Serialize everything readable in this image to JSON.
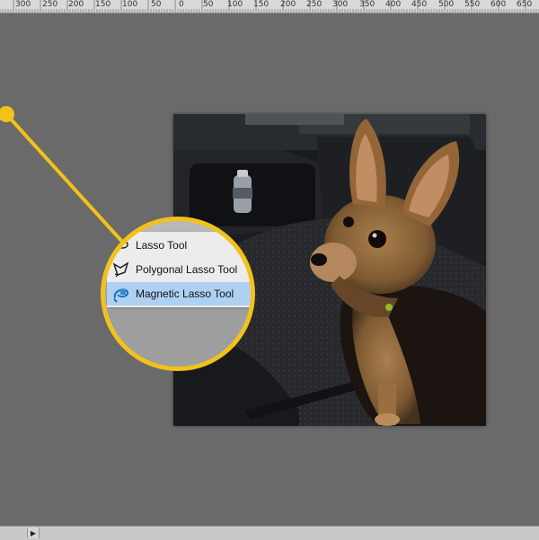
{
  "ruler": {
    "labels": [
      "300",
      "250",
      "200",
      "150",
      "100",
      "50",
      "0",
      "50",
      "100",
      "150",
      "200",
      "250",
      "300",
      "350",
      "400",
      "450",
      "500",
      "550",
      "600",
      "650"
    ]
  },
  "menu": {
    "items": [
      {
        "label": "Lasso Tool",
        "icon": "lasso-icon",
        "selected": false
      },
      {
        "label": "Polygonal Lasso Tool",
        "icon": "polygonal-lasso-icon",
        "selected": false
      },
      {
        "label": "Magnetic Lasso Tool",
        "icon": "magnetic-lasso-icon",
        "selected": true
      }
    ]
  },
  "colors": {
    "canvas": "#6a6a6a",
    "callout": "#f2c21b",
    "selection": "#aed0f3"
  }
}
